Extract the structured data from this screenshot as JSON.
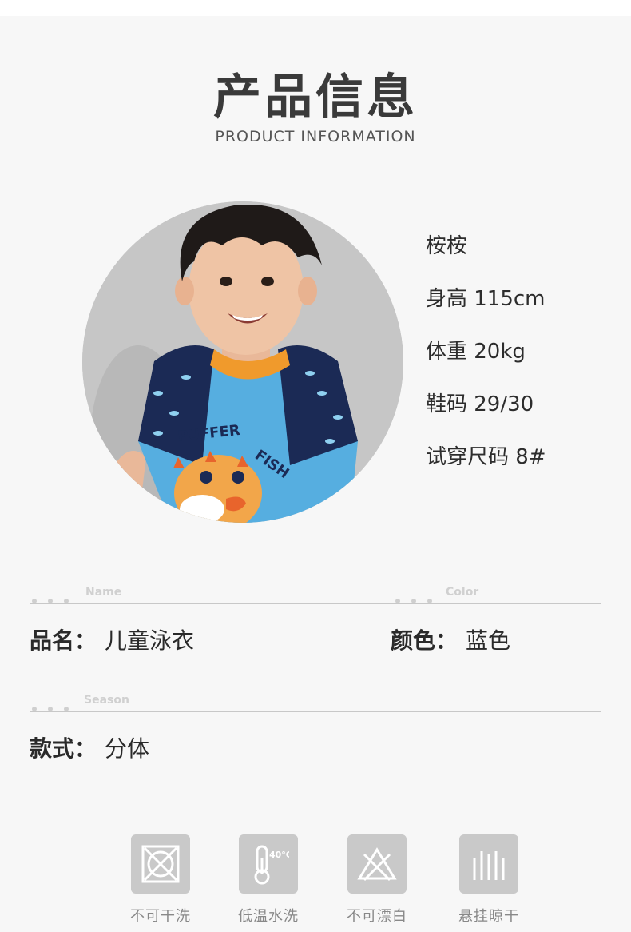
{
  "header": {
    "title": "产品信息",
    "subtitle": "PRODUCT INFORMATION"
  },
  "model": {
    "photo": "boy-model-wearing-puffer-fish-swim-shirt",
    "name": "桉桉",
    "height": "身高 115cm",
    "weight": "体重 20kg",
    "shoe_size": "鞋码 29/30",
    "trial_size": "试穿尺码 8#",
    "shirt_print": "PUFFER FISH"
  },
  "sections": {
    "name_label": "Name",
    "color_label": "Color",
    "season_label": "Season"
  },
  "fields": {
    "product_name_key": "品名：",
    "product_name_value": "儿童泳衣",
    "color_key": "颜色：",
    "color_value": "蓝色",
    "style_key": "款式：",
    "style_value": "分体"
  },
  "care": [
    {
      "icon": "no-dry-clean-icon",
      "label": "不可干洗"
    },
    {
      "icon": "low-temp-wash-icon",
      "label": "低温水洗"
    },
    {
      "icon": "no-bleach-icon",
      "label": "不可漂白"
    },
    {
      "icon": "hang-dry-icon",
      "label": "悬挂晾干"
    }
  ],
  "colors": {
    "background": "#f7f7f7",
    "icon_tile": "#c9c9c9",
    "shirt_blue": "#56aee0",
    "shirt_navy": "#1b2a55",
    "collar_orange": "#f09a2c"
  }
}
